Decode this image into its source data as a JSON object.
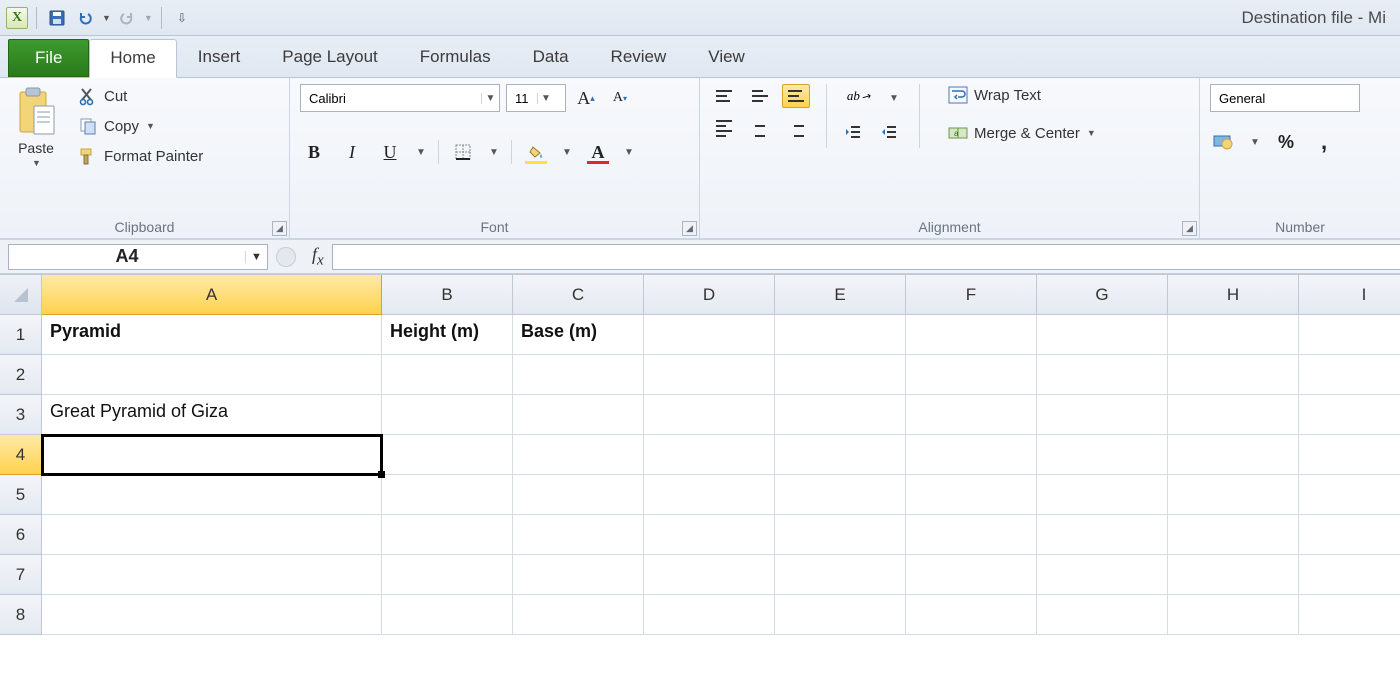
{
  "window_title": "Destination file  -  Mi",
  "qat": {
    "app_tooltip": "Excel"
  },
  "tabs": {
    "file": "File",
    "items": [
      "Home",
      "Insert",
      "Page Layout",
      "Formulas",
      "Data",
      "Review",
      "View"
    ],
    "active": "Home"
  },
  "ribbon": {
    "clipboard": {
      "label": "Clipboard",
      "paste": "Paste",
      "cut": "Cut",
      "copy": "Copy",
      "format_painter": "Format Painter"
    },
    "font": {
      "label": "Font",
      "font_name": "Calibri",
      "font_size": "11"
    },
    "alignment": {
      "label": "Alignment",
      "wrap": "Wrap Text",
      "merge": "Merge & Center"
    },
    "number": {
      "label": "Number",
      "format": "General"
    }
  },
  "namebox": "A4",
  "formula": "",
  "columns": [
    "A",
    "B",
    "C",
    "D",
    "E",
    "F",
    "G",
    "H",
    "I"
  ],
  "rows": [
    "1",
    "2",
    "3",
    "4",
    "5",
    "6",
    "7",
    "8"
  ],
  "active_col": "A",
  "active_row": "4",
  "cells": {
    "r1": {
      "A": "Pyramid",
      "B": "Height (m)",
      "C": "Base (m)"
    },
    "r3": {
      "A": "Great Pyramid of Giza"
    }
  }
}
